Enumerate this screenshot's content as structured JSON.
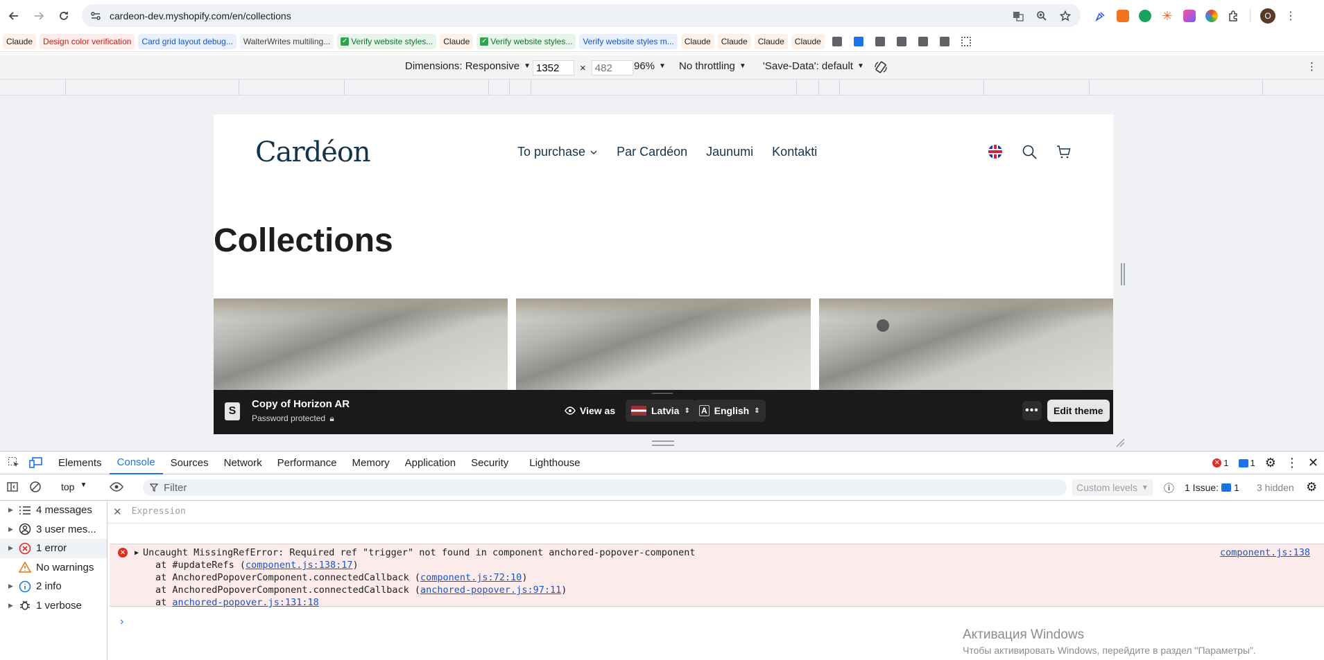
{
  "browser": {
    "url": "cardeon-dev.myshopify.com/en/collections",
    "profile_initial": "O",
    "bookmarks": [
      {
        "label": "Claude",
        "style": "claude"
      },
      {
        "label": "Design color verification",
        "style": "red"
      },
      {
        "label": "Card grid layout debug...",
        "style": "blue"
      },
      {
        "label": "WalterWrites multiling...",
        "style": "plain"
      },
      {
        "label": "Verify website styles...",
        "style": "check"
      },
      {
        "label": "Claude",
        "style": "claude"
      },
      {
        "label": "Verify website styles...",
        "style": "check"
      },
      {
        "label": "Verify website styles m...",
        "style": "blue"
      },
      {
        "label": "Claude",
        "style": "claude"
      },
      {
        "label": "Claude",
        "style": "claude"
      },
      {
        "label": "Claude",
        "style": "claude"
      },
      {
        "label": "Claude",
        "style": "claude"
      }
    ]
  },
  "device_toolbar": {
    "dimensions_label": "Dimensions: Responsive",
    "width": "1352",
    "height_placeholder": "482",
    "times": "×",
    "zoom": "96%",
    "throttling": "No throttling",
    "save_data": "'Save-Data': default"
  },
  "site": {
    "logo": "Cardéon",
    "nav": [
      "To purchase",
      "Par Cardéon",
      "Jaunumi",
      "Kontakti"
    ],
    "page_title": "Collections"
  },
  "shopify_bar": {
    "theme_name": "Copy of Horizon AR",
    "password_status": "Password protected",
    "view_as": "View as",
    "country": "Latvia",
    "language": "English",
    "edit_theme": "Edit theme"
  },
  "devtools": {
    "tabs": [
      "Elements",
      "Console",
      "Sources",
      "Network",
      "Performance",
      "Memory",
      "Application",
      "Security",
      "Lighthouse"
    ],
    "active_tab": "Console",
    "error_count": "1",
    "message_count": "1",
    "context": "top",
    "filter_placeholder": "Filter",
    "custom_levels": "Custom levels",
    "issues_label": "1 Issue:",
    "issues_count": "1",
    "hidden": "3 hidden",
    "expression_placeholder": "Expression",
    "sidebar": [
      {
        "label": "4 messages",
        "icon": "list-icon"
      },
      {
        "label": "3 user mes...",
        "icon": "user-icon"
      },
      {
        "label": "1 error",
        "icon": "error-icon"
      },
      {
        "label": "No warnings",
        "icon": "warning-icon"
      },
      {
        "label": "2 info",
        "icon": "info-icon"
      },
      {
        "label": "1 verbose",
        "icon": "bug-icon"
      }
    ],
    "error": {
      "message": "Uncaught MissingRefError: Required ref \"trigger\" not found in component anchored-popover-component",
      "source": "component.js:138",
      "stack": [
        {
          "prefix": "at #updateRefs (",
          "link": "component.js:138:17",
          "suffix": ")"
        },
        {
          "prefix": "at AnchoredPopoverComponent.connectedCallback (",
          "link": "component.js:72:10",
          "suffix": ")"
        },
        {
          "prefix": "at AnchoredPopoverComponent.connectedCallback (",
          "link": "anchored-popover.js:97:11",
          "suffix": ")"
        },
        {
          "prefix": "at ",
          "link": "anchored-popover.js:131:18",
          "suffix": ""
        }
      ]
    }
  },
  "windows_activation": {
    "title": "Активация Windows",
    "subtitle": "Чтобы активировать Windows, перейдите в раздел \"Параметры\"."
  }
}
